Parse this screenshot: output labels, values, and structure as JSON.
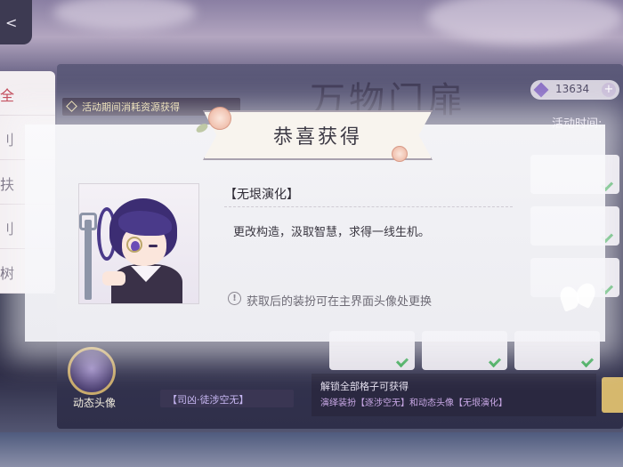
{
  "background": {
    "back_glyph": "<",
    "side_nav": [
      {
        "label": "全",
        "active": true
      },
      {
        "label": "刂",
        "active": false
      },
      {
        "label": "扶",
        "active": false
      },
      {
        "label": "刂",
        "active": false
      },
      {
        "label": "树",
        "active": false
      }
    ],
    "event_banner": "活动期间消耗资源获得",
    "title_art": "万物门扉",
    "currency": {
      "icon": "gem-icon",
      "amount": "13634",
      "add_glyph": "+"
    },
    "event_time_label": "活动时间:",
    "unlock": {
      "title": "解锁全部格子可获得",
      "subtitle": "演绎装扮【逐涉空无】和动态头像【无垠演化】"
    },
    "avatar_label": "动态头像",
    "avatar_name": "【司凶·徒涉空无】"
  },
  "popup": {
    "title": "恭喜获得",
    "item": {
      "name": "【无垠演化】",
      "description": "更改构造，汲取智慧，求得一线生机。",
      "note_icon": "!",
      "note": "获取后的装扮可在主界面头像处更换"
    }
  },
  "colors": {
    "ribbon_border": "#a9a1ae",
    "check_green": "#2fa34a",
    "accent_purple": "#8a6fc4"
  }
}
